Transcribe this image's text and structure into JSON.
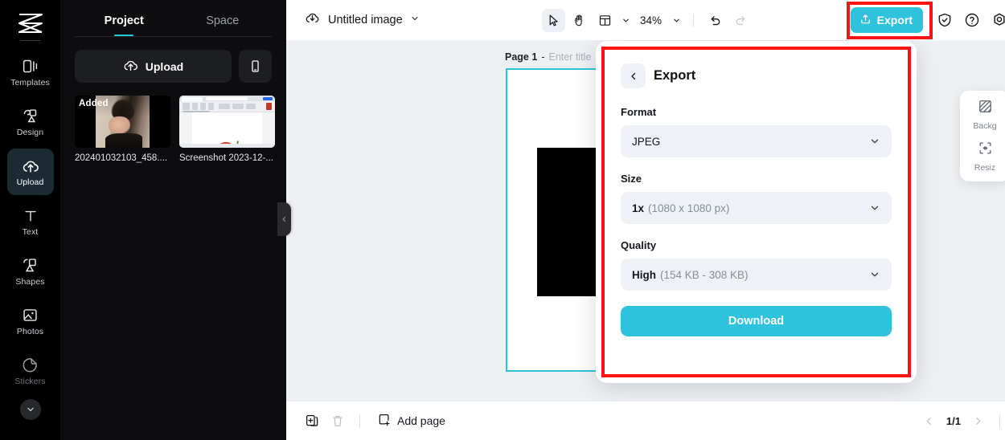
{
  "brand": {
    "logo_name": "capcut-logo"
  },
  "rail": {
    "items": [
      {
        "label": "Templates",
        "icon": "templates-icon",
        "active": false
      },
      {
        "label": "Design",
        "icon": "design-icon",
        "active": false
      },
      {
        "label": "Upload",
        "icon": "upload-cloud-icon",
        "active": true
      },
      {
        "label": "Text",
        "icon": "text-icon",
        "active": false
      },
      {
        "label": "Shapes",
        "icon": "shapes-icon",
        "active": false
      },
      {
        "label": "Photos",
        "icon": "photos-icon",
        "active": false
      },
      {
        "label": "Stickers",
        "icon": "stickers-icon",
        "active": false
      }
    ],
    "more_icon": "chevron-down-icon"
  },
  "panel": {
    "tabs": [
      {
        "label": "Project",
        "active": true
      },
      {
        "label": "Space",
        "active": false
      }
    ],
    "upload_label": "Upload",
    "upload_icon": "upload-cloud-icon",
    "phone_icon": "mobile-phone-icon",
    "assets": [
      {
        "name": "202401032103_458....",
        "badge": "Added"
      },
      {
        "name": "Screenshot 2023-12-...",
        "badge": ""
      }
    ],
    "collapse_icon": "chevron-left-icon"
  },
  "topbar": {
    "cloud_icon": "cloud-sync-icon",
    "doc_title": "Untitled image",
    "doc_caret_icon": "chevron-down-icon",
    "tools": [
      {
        "name": "select-tool",
        "icon": "cursor-arrow-icon",
        "active": true
      },
      {
        "name": "hand-tool",
        "icon": "hand-icon",
        "active": false
      },
      {
        "name": "layout-tool",
        "icon": "layout-grid-icon",
        "active": false
      }
    ],
    "zoom_level": "34%",
    "undo_icon": "undo-arrow-icon",
    "redo_icon": "redo-arrow-icon",
    "export_label": "Export",
    "export_icon": "upload-box-icon",
    "export_color": "#2ec2dd",
    "right_icons": [
      {
        "name": "shield-check-icon"
      },
      {
        "name": "help-question-icon"
      },
      {
        "name": "settings-gear-icon"
      }
    ]
  },
  "canvas": {
    "page_number": "Page 1",
    "page_dash": "-",
    "title_placeholder": "Enter title",
    "selection_color": "#2ec2dd"
  },
  "right_panel": {
    "items": [
      {
        "label": "Backg",
        "icon": "background-hatch-icon"
      },
      {
        "label": "Resiz",
        "icon": "resize-frame-icon"
      }
    ]
  },
  "export_dialog": {
    "back_icon": "chevron-left-icon",
    "title": "Export",
    "fields": [
      {
        "label": "Format",
        "value": "JPEG",
        "hint": "",
        "bold_value": false
      },
      {
        "label": "Size",
        "value": "1x",
        "hint": "(1080 x 1080 px)",
        "bold_value": true
      },
      {
        "label": "Quality",
        "value": "High",
        "hint": "(154 KB - 308 KB)",
        "bold_value": true
      }
    ],
    "caret_icon": "chevron-down-icon",
    "download_label": "Download",
    "download_color": "#2ec2dd"
  },
  "bottombar": {
    "duplicate_icon": "duplicate-page-icon",
    "delete_icon": "trash-icon",
    "add_page_label": "Add page",
    "add_page_icon": "page-plus-icon",
    "prev_icon": "chevron-left-icon",
    "page_indicator": "1/1",
    "next_icon": "chevron-right-icon"
  },
  "annotations": {
    "color": "#f91313",
    "boxes": [
      "export-button-highlight",
      "export-dialog-highlight"
    ]
  }
}
